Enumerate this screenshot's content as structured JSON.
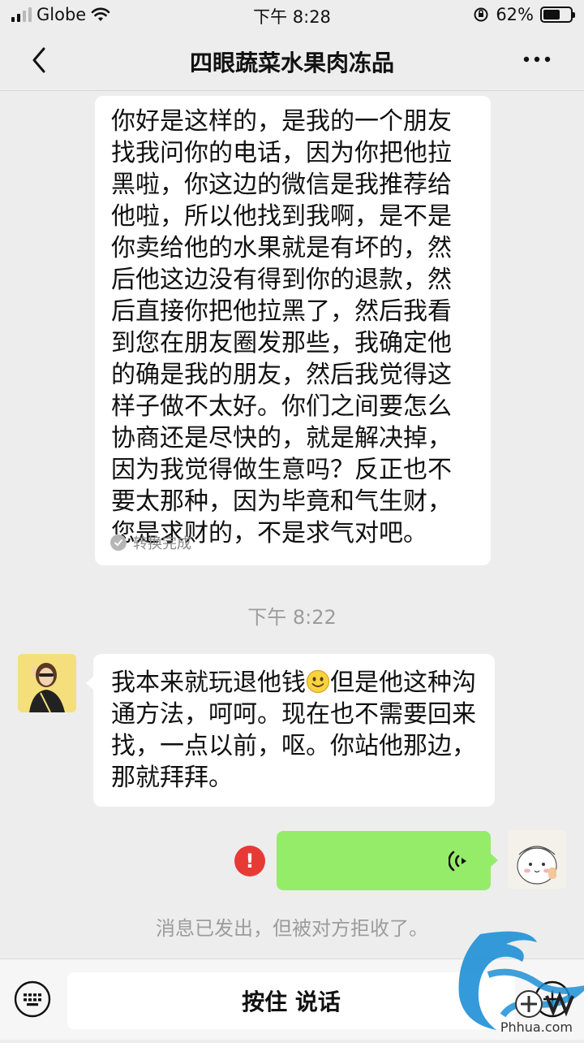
{
  "status_bar": {
    "carrier": "Globe",
    "time": "下午 8:28",
    "battery": "62%",
    "battery_level": 0.62
  },
  "nav": {
    "title": "四眼蔬菜水果肉冻品"
  },
  "messages": {
    "incoming_1": {
      "text": "你好是这样的，是我的一个朋友找我问你的电话，因为你把他拉黑啦，你这边的微信是我推荐给他啦，所以他找到我啊，是不是你卖给他的水果就是有坏的，然后他这边没有得到你的退款，然后直接你把他拉黑了，然后我看到您在朋友圈发那些，我确定他的确是我的朋友，然后我觉得这样子做不太好。你们之间要怎么协商还是尽快的，就是解决掉，因为我觉得做生意吗？反正也不要太那种，因为毕竟和气生财，您是求财的，不是求气对吧。",
      "conversion_status": "转换完成"
    },
    "timestamp": "下午 8:22",
    "incoming_2": {
      "text_before_emoji": "我本来就玩退他钱",
      "text_after_emoji": "但是他这种沟通方法，呵呵。现在也不需要回来找，一点以前，呕。你站他那边，那就拜拜。",
      "emoji": "smiley-icon"
    },
    "outgoing_voice": {
      "type": "voice",
      "status": "failed"
    },
    "system_notice": "消息已发出，但被对方拒收了。"
  },
  "input_bar": {
    "hold_to_talk": "按住 说话"
  },
  "watermark": {
    "site": "Phhua.com"
  },
  "colors": {
    "background": "#ededed",
    "outgoing_bubble": "#95ec69",
    "error": "#e83a35"
  }
}
